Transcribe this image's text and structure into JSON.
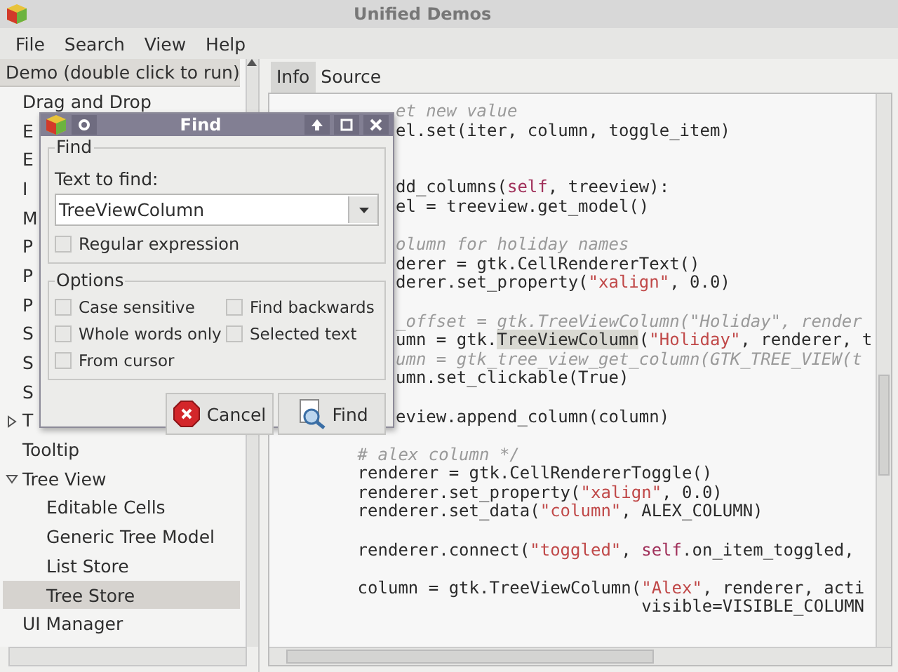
{
  "window": {
    "title": "Unified Demos"
  },
  "menu": [
    "File",
    "Search",
    "View",
    "Help"
  ],
  "tree": {
    "header": "Demo (double click to run)",
    "items": [
      {
        "label": "Drag and Drop",
        "selected": false
      },
      {
        "label": "E",
        "selected": false
      },
      {
        "label": "E",
        "selected": false
      },
      {
        "label": "I",
        "selected": false
      },
      {
        "label": "M",
        "selected": false
      },
      {
        "label": "P",
        "selected": false
      },
      {
        "label": "P",
        "selected": false
      },
      {
        "label": "P",
        "selected": false
      },
      {
        "label": "S",
        "selected": false
      },
      {
        "label": "S",
        "selected": false
      },
      {
        "label": "S",
        "selected": false
      },
      {
        "label": "T",
        "selected": false,
        "expanded": false
      },
      {
        "label": "Tooltip",
        "selected": false
      },
      {
        "label": "Tree View",
        "selected": false,
        "expanded": true,
        "children": [
          {
            "label": "Editable Cells",
            "selected": false
          },
          {
            "label": "Generic Tree Model",
            "selected": false
          },
          {
            "label": "List Store",
            "selected": false
          },
          {
            "label": "Tree Store",
            "selected": true
          }
        ]
      },
      {
        "label": "UI Manager",
        "selected": false
      }
    ]
  },
  "tabs": [
    {
      "label": "Info",
      "selected": true
    },
    {
      "label": "Source",
      "selected": false
    }
  ],
  "code": [
    {
      "kind": "clipped",
      "parts": [
        {
          "t": "et new value",
          "kind": "comment"
        }
      ]
    },
    {
      "kind": "clipped",
      "parts": [
        {
          "t": "el.set(iter, column, toggle_item)",
          "kind": "plain"
        }
      ]
    },
    {
      "kind": "blank"
    },
    {
      "kind": "blank"
    },
    {
      "kind": "clipped",
      "parts": [
        {
          "t": "dd_columns(",
          "kind": "plain"
        },
        {
          "t": "self",
          "kind": "keyword"
        },
        {
          "t": ", treeview):",
          "kind": "plain"
        }
      ]
    },
    {
      "kind": "clipped",
      "parts": [
        {
          "t": "el = treeview.get_model()",
          "kind": "plain"
        }
      ]
    },
    {
      "kind": "blank"
    },
    {
      "kind": "clipped",
      "parts": [
        {
          "t": "olumn for holiday names",
          "kind": "comment"
        }
      ]
    },
    {
      "kind": "clipped",
      "parts": [
        {
          "t": "derer = gtk.CellRendererText()",
          "kind": "plain"
        }
      ]
    },
    {
      "kind": "clipped",
      "parts": [
        {
          "t": "derer.set_property(",
          "kind": "plain"
        },
        {
          "t": "\"xalign\"",
          "kind": "string"
        },
        {
          "t": ", 0.0)",
          "kind": "plain"
        }
      ]
    },
    {
      "kind": "blank"
    },
    {
      "kind": "clipped",
      "parts": [
        {
          "t": "_offset = gtk.TreeViewColumn(\"Holiday\", render",
          "kind": "comment"
        }
      ]
    },
    {
      "kind": "clipped",
      "parts": [
        {
          "t": "umn = gtk.",
          "kind": "plain"
        },
        {
          "t": "TreeViewColumn",
          "kind": "match"
        },
        {
          "t": "(",
          "kind": "plain"
        },
        {
          "t": "\"Holiday\"",
          "kind": "string"
        },
        {
          "t": ", renderer, t",
          "kind": "plain"
        }
      ]
    },
    {
      "kind": "clipped",
      "parts": [
        {
          "t": "umn = gtk_tree_view_get_column(GTK_TREE_VIEW(t",
          "kind": "comment"
        }
      ]
    },
    {
      "kind": "clipped",
      "parts": [
        {
          "t": "umn.set_clickable(True)",
          "kind": "plain"
        }
      ]
    },
    {
      "kind": "blank"
    },
    {
      "kind": "clipped",
      "parts": [
        {
          "t": "eview.append_column(column)",
          "kind": "plain"
        }
      ]
    },
    {
      "kind": "blank"
    },
    {
      "kind": "full",
      "parts": [
        {
          "t": "        # alex column */",
          "kind": "comment"
        }
      ]
    },
    {
      "kind": "full",
      "parts": [
        {
          "t": "        renderer = gtk.CellRendererToggle()",
          "kind": "plain"
        }
      ]
    },
    {
      "kind": "full",
      "parts": [
        {
          "t": "        renderer.set_property(",
          "kind": "plain"
        },
        {
          "t": "\"xalign\"",
          "kind": "string"
        },
        {
          "t": ", 0.0)",
          "kind": "plain"
        }
      ]
    },
    {
      "kind": "full",
      "parts": [
        {
          "t": "        renderer.set_data(",
          "kind": "plain"
        },
        {
          "t": "\"column\"",
          "kind": "string"
        },
        {
          "t": ", ALEX_COLUMN)",
          "kind": "plain"
        }
      ]
    },
    {
      "kind": "blank"
    },
    {
      "kind": "full",
      "parts": [
        {
          "t": "        renderer.connect(",
          "kind": "plain"
        },
        {
          "t": "\"toggled\"",
          "kind": "string"
        },
        {
          "t": ", ",
          "kind": "plain"
        },
        {
          "t": "self",
          "kind": "keyword"
        },
        {
          "t": ".on_item_toggled, ",
          "kind": "plain"
        }
      ]
    },
    {
      "kind": "blank"
    },
    {
      "kind": "full",
      "parts": [
        {
          "t": "        column = gtk.TreeViewColumn(",
          "kind": "plain"
        },
        {
          "t": "\"Alex\"",
          "kind": "string"
        },
        {
          "t": ", renderer, acti",
          "kind": "plain"
        }
      ]
    },
    {
      "kind": "full",
      "parts": [
        {
          "t": "                                    visible=VISIBLE_COLUMN",
          "kind": "plain"
        }
      ]
    }
  ],
  "dialog": {
    "title": "Find",
    "find_frame": {
      "title": "Find",
      "label": "Text to find:",
      "value": "TreeViewColumn",
      "regex": {
        "label": "Regular expression",
        "checked": false
      }
    },
    "options_frame": {
      "title": "Options",
      "options": [
        {
          "label": "Case sensitive",
          "checked": false
        },
        {
          "label": "Find backwards",
          "checked": false
        },
        {
          "label": "Whole words only",
          "checked": false
        },
        {
          "label": "Selected text",
          "checked": false
        },
        {
          "label": "From cursor",
          "checked": false
        }
      ]
    },
    "buttons": [
      {
        "label": "Cancel",
        "kind": "cancel"
      },
      {
        "label": "Find",
        "kind": "find"
      }
    ]
  }
}
